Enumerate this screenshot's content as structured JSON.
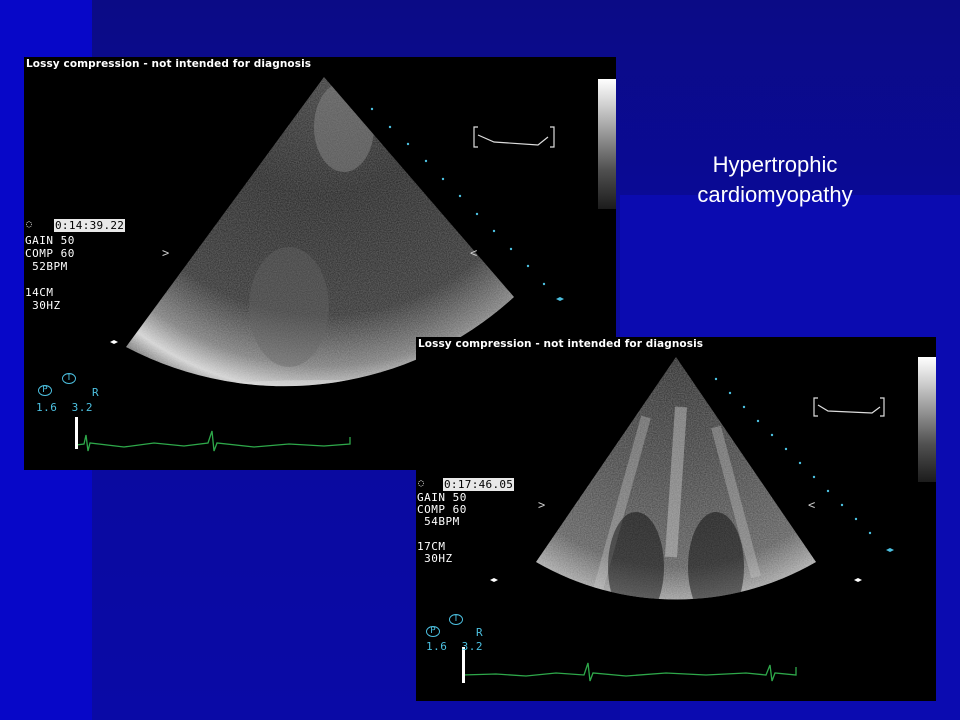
{
  "slide": {
    "title": "Hypertrophic cardiomyopathy"
  },
  "echo_top": {
    "header": "Lossy compression - not intended for diagnosis",
    "time": "0:14:39.22",
    "gain": "GAIN 50",
    "comp": "COMP 60",
    "bpm": " 52BPM",
    "depth": "14CM",
    "frame_rate": " 30HZ",
    "probe_p": "P",
    "probe_t": "T",
    "probe_r": "R",
    "probe_values": "1.6  3.2"
  },
  "echo_bottom": {
    "header": "Lossy compression - not intended for diagnosis",
    "time": "0:17:46.05",
    "gain": "GAIN 50",
    "comp": "COMP 60",
    "bpm": " 54BPM",
    "depth": "17CM",
    "frame_rate": " 30HZ",
    "probe_p": "P",
    "probe_t": "T",
    "probe_r": "R",
    "probe_values": "1.6  3.2"
  },
  "colors": {
    "background": "#0a0aa8",
    "ecg_trace": "#2ea84a",
    "depth_marker": "#4cc0e0"
  }
}
